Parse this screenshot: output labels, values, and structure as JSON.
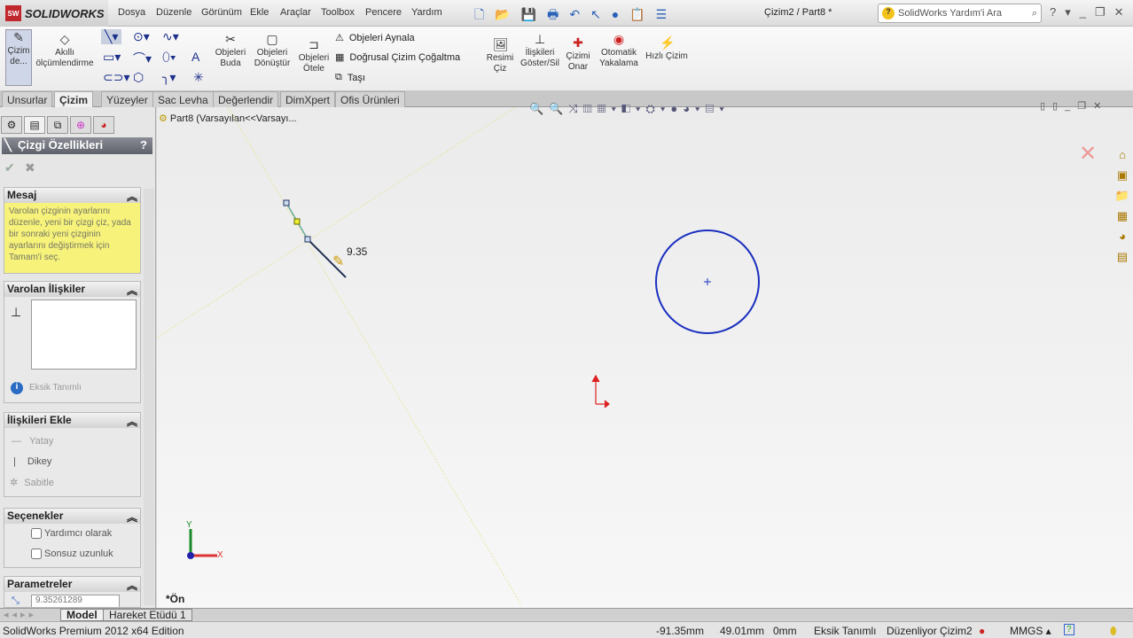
{
  "app": {
    "brand": "SOLIDWORKS",
    "brand_badge": "SW",
    "document_title": "Çizim2 / Part8 *"
  },
  "menu": [
    "Dosya",
    "Düzenle",
    "Görünüm",
    "Ekle",
    "Araçlar",
    "Toolbox",
    "Pencere",
    "Yardım"
  ],
  "search": {
    "placeholder": "SolidWorks Yardım'i Ara"
  },
  "ribbon": {
    "cizim": "Çizim de...",
    "akilli": "Akıllı ölçümlendirme",
    "buda": "Objeleri Buda",
    "donustur": "Objeleri Dönüştür",
    "otele": "Objeleri Ötele",
    "aynala": "Objeleri Aynala",
    "cogalt": "Doğrusal Çizim Çoğaltma",
    "tasi": "Taşı",
    "resim": "Resimi Çiz",
    "iliskiler": "İlişkileri Göster/Sil",
    "onar": "Çizimi Onar",
    "yakalama": "Otomatik Yakalama",
    "hizli": "Hızlı Çizim"
  },
  "tabs": [
    "Unsurlar",
    "Çizim",
    "Yüzeyler",
    "Sac Levha",
    "Değerlendir",
    "DimXpert",
    "Ofis Ürünleri"
  ],
  "active_tab": "Çizim",
  "panel": {
    "title": "Çizgi Özellikleri",
    "help": "?",
    "mesaj": {
      "title": "Mesaj",
      "text": "Varolan çizginin ayarlarını düzenle, yeni bir çizgi çiz, yada bir sonraki yeni çizginin ayarlarını değiştirmek için Tamam'i seç."
    },
    "varolan": {
      "title": "Varolan İlişkiler",
      "status": "Eksik Tanımlı"
    },
    "ekle": {
      "title": "İlişkileri Ekle",
      "items": [
        "Yatay",
        "Dikey",
        "Sabitle"
      ]
    },
    "secenekler": {
      "title": "Seçenekler",
      "items": [
        "Yardımcı olarak",
        "Sonsuz uzunluk"
      ]
    },
    "parametreler": {
      "title": "Parametreler",
      "value": "9.35261289"
    }
  },
  "canvas": {
    "tree_label": "Part8  (Varsayılan<<Varsayı...",
    "dimension": "9.35",
    "view_name": "*Ön",
    "axis_x": "X",
    "axis_y": "Y"
  },
  "bottom_tabs": [
    "Model",
    "Hareket Etüdü 1"
  ],
  "status": {
    "edition": "SolidWorks Premium 2012 x64 Edition",
    "x": "-91.35mm",
    "y": "49.01mm",
    "z": "0mm",
    "state": "Eksik Tanımlı",
    "editing": "Düzenliyor Çizim2",
    "units": "MMGS ▴"
  }
}
